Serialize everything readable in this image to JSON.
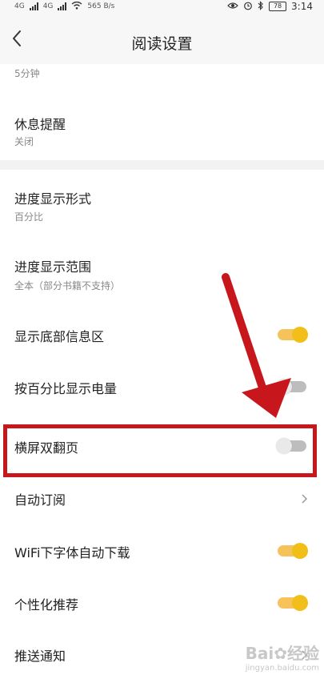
{
  "status_bar": {
    "net_labels": [
      "4G",
      "HD",
      "4G",
      "HD"
    ],
    "speed": "565",
    "speed_unit": "B/s",
    "battery": "78",
    "time": "3:14"
  },
  "header": {
    "title": "阅读设置"
  },
  "card1": {
    "partial_sub": "5分钟",
    "rest_reminder": {
      "title": "休息提醒",
      "value": "关闭"
    }
  },
  "card2": {
    "progress_style": {
      "title": "进度显示形式",
      "value": "百分比"
    },
    "progress_range": {
      "title": "进度显示范围",
      "value": "全本（部分书籍不支持）"
    },
    "show_bottom_info": {
      "title": "显示底部信息区",
      "enabled": true
    },
    "battery_percent": {
      "title": "按百分比显示电量",
      "enabled": false
    },
    "landscape_double": {
      "title": "横屏双翻页",
      "enabled": false
    },
    "auto_subscribe": {
      "title": "自动订阅"
    },
    "wifi_font_download": {
      "title": "WiFi下字体自动下载",
      "enabled": true
    },
    "personalized": {
      "title": "个性化推荐",
      "enabled": true
    },
    "push_notify": {
      "title": "推送通知"
    }
  },
  "watermark": {
    "main": "Bai",
    "main2": "经验",
    "sub": "jingyan.baidu.com"
  },
  "colors": {
    "toggle_on": "#f2be1a",
    "highlight": "#c8161d",
    "arrow": "#c8161d"
  }
}
